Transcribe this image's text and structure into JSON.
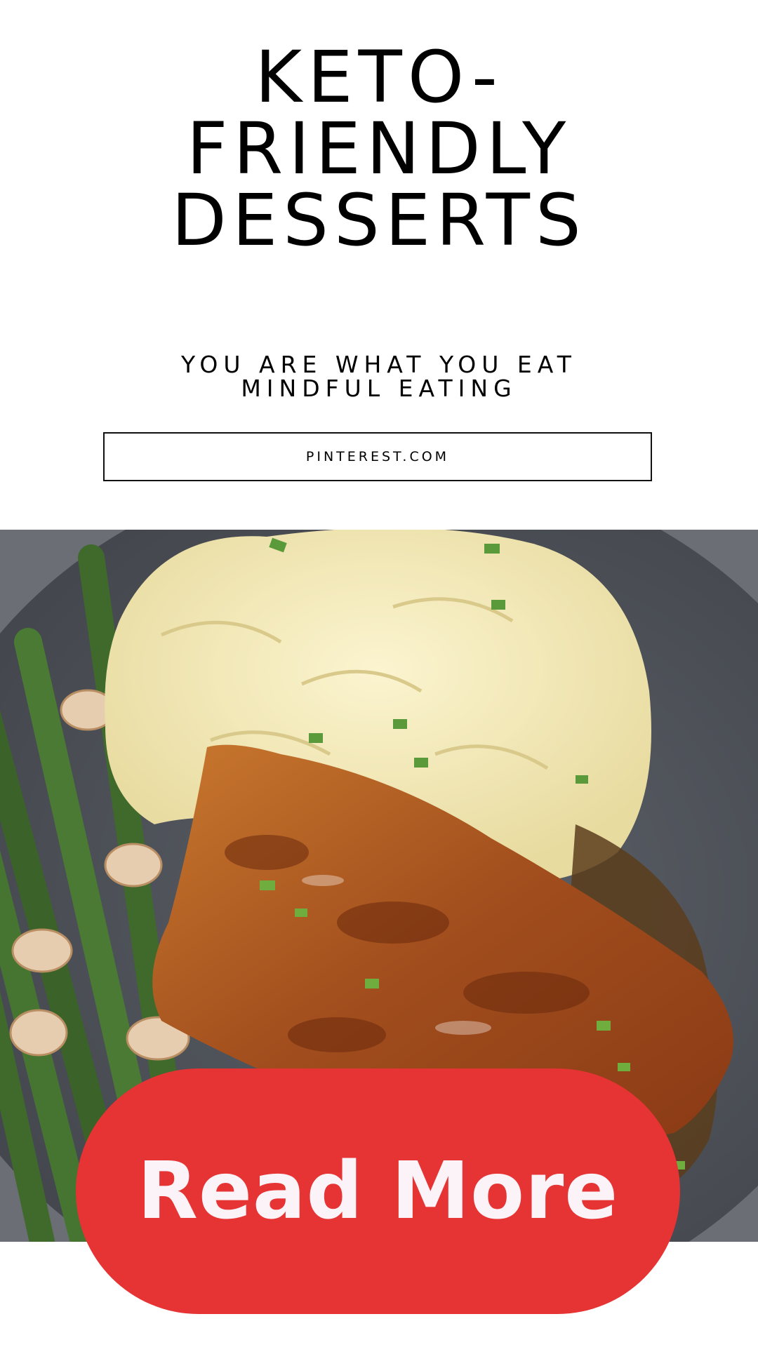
{
  "title": {
    "line1": "KETO-",
    "line2": "FRIENDLY",
    "line3": "DESSERTS"
  },
  "subtitle": {
    "line1": "YOU ARE WHAT YOU EAT",
    "line2": "MINDFUL EATING"
  },
  "source": {
    "label": "PINTEREST.COM"
  },
  "cta": {
    "label": "Read More"
  },
  "colors": {
    "accent": "#e63334",
    "cta_text": "#fbf3f7",
    "plate": "#4c5058",
    "background": "#ffffff"
  }
}
